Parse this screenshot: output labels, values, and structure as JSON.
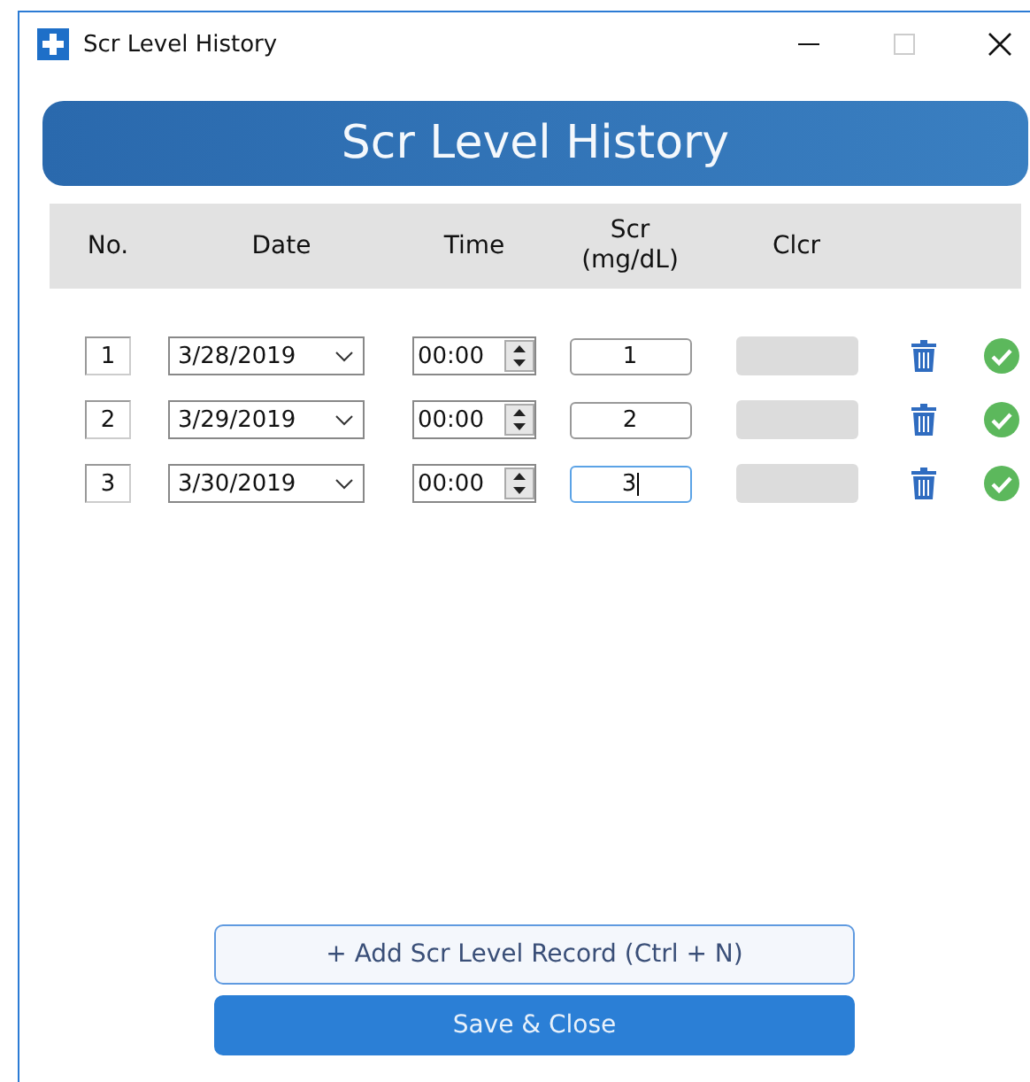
{
  "window": {
    "title": "Scr Level History"
  },
  "header": {
    "title": "Scr Level History"
  },
  "table": {
    "columns": [
      "No.",
      "Date",
      "Time",
      "Scr\n(mg/dL)",
      "Clcr"
    ],
    "rows": [
      {
        "no": "1",
        "date": "3/28/2019",
        "time": "00:00",
        "scr": "1",
        "focused": false
      },
      {
        "no": "2",
        "date": "3/29/2019",
        "time": "00:00",
        "scr": "2",
        "focused": false
      },
      {
        "no": "3",
        "date": "3/30/2019",
        "time": "00:00",
        "scr": "3",
        "focused": true
      }
    ]
  },
  "buttons": [
    {
      "label": "+ Add Scr Level Record (Ctrl + N)",
      "kind": "secondary"
    },
    {
      "label": "Save & Close",
      "kind": "primary"
    }
  ]
}
